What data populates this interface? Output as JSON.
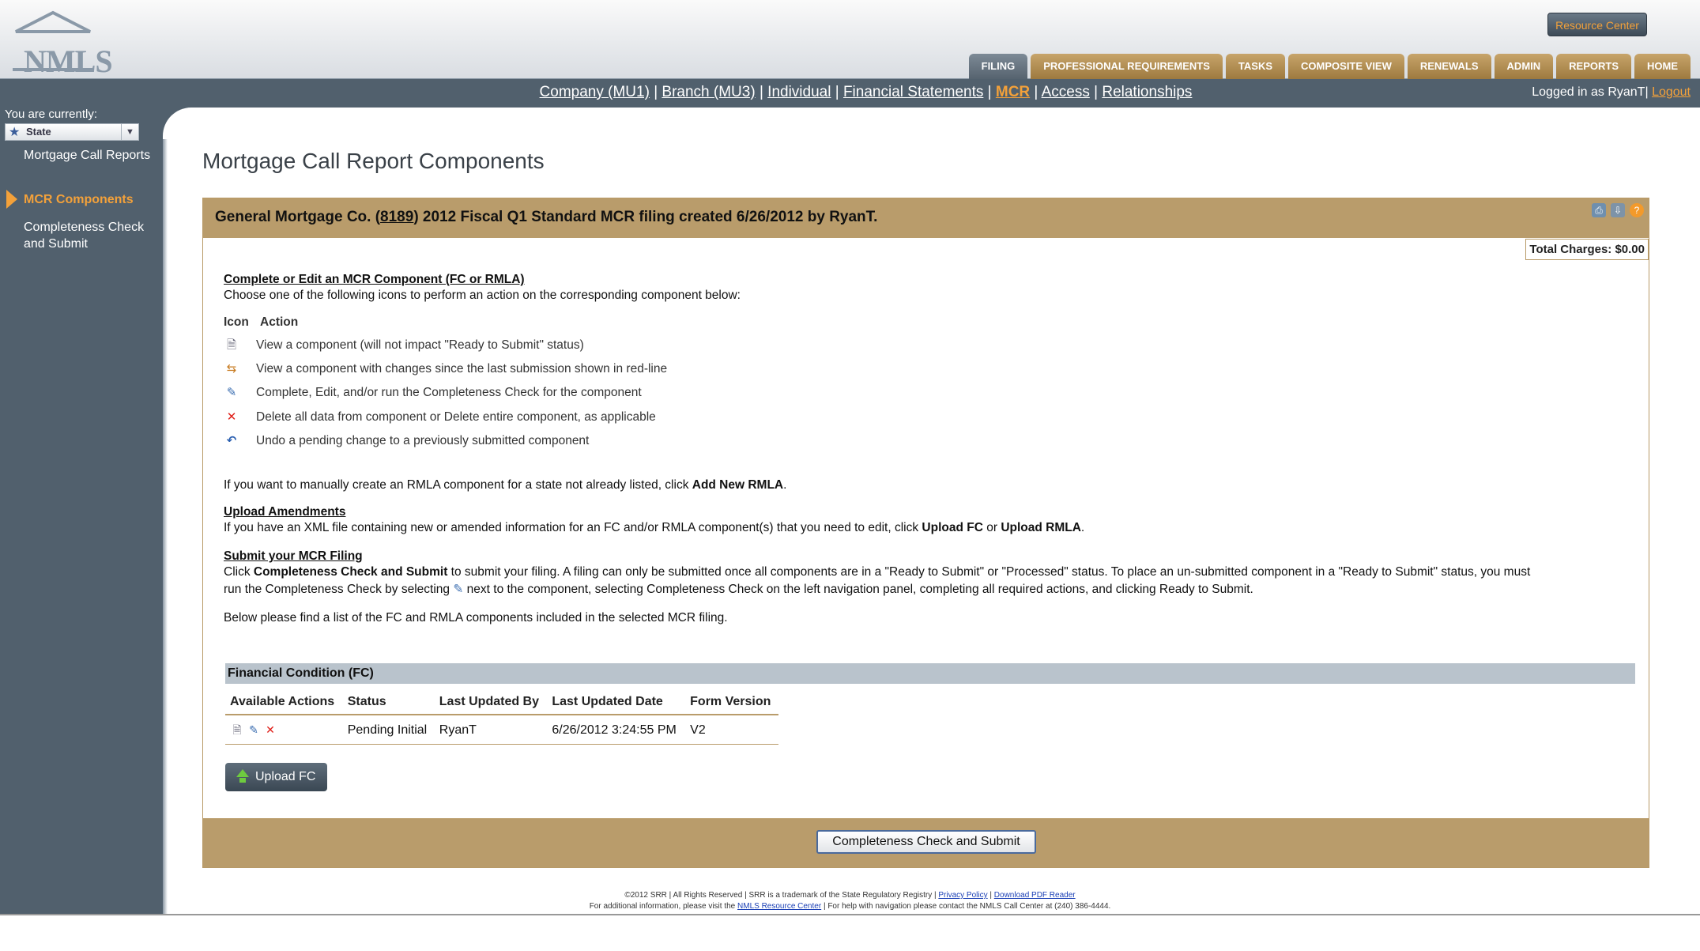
{
  "header": {
    "logo_text": "NMLS",
    "resource_center": "Resource Center",
    "tabs": [
      {
        "label": "FILING",
        "active": true
      },
      {
        "label": "PROFESSIONAL REQUIREMENTS",
        "active": false
      },
      {
        "label": "TASKS",
        "active": false
      },
      {
        "label": "COMPOSITE VIEW",
        "active": false
      },
      {
        "label": "RENEWALS",
        "active": false
      },
      {
        "label": "ADMIN",
        "active": false
      },
      {
        "label": "REPORTS",
        "active": false
      },
      {
        "label": "HOME",
        "active": false
      }
    ]
  },
  "subnav": {
    "links": [
      "Company (MU1)",
      "Branch (MU3)",
      "Individual",
      "Financial Statements",
      "MCR",
      "Access",
      "Relationships"
    ],
    "current": "MCR",
    "separator": " | ",
    "logged_in": "Logged in as RyanT",
    "logout": "Logout"
  },
  "sidebar": {
    "you_are": "You are currently:",
    "state_value": "State",
    "items": [
      {
        "label": "Mortgage Call Reports",
        "current": false
      },
      {
        "label": "MCR Components",
        "current": true
      },
      {
        "label": "Completeness Check and Submit",
        "current": false
      }
    ]
  },
  "main": {
    "page_title": "Mortgage Call Report Components",
    "panel_head": {
      "prefix": "General Mortgage Co. (",
      "id": "8189",
      "suffix": ") 2012 Fiscal Q1 Standard MCR filing created 6/26/2012 by RyanT."
    },
    "total_charges": "Total Charges: $0.00",
    "complete_heading": "Complete or Edit an MCR Component (FC or RMLA)",
    "complete_intro": "Choose one of the following icons to perform an action on the corresponding component below:",
    "legend_col_icon": "Icon",
    "legend_col_action": "Action",
    "legend": [
      {
        "icon": "view-document-icon",
        "text": "View a component (will not impact \"Ready to Submit\" status)"
      },
      {
        "icon": "view-changes-icon",
        "text": "View a component with changes since the last submission shown in red-line"
      },
      {
        "icon": "edit-icon",
        "text": "Complete, Edit, and/or run the Completeness Check for the component"
      },
      {
        "icon": "delete-icon",
        "text": "Delete all data from component or Delete entire component, as applicable"
      },
      {
        "icon": "undo-icon",
        "text": "Undo a pending change to a previously submitted component"
      }
    ],
    "rmla_text_pre": "If you want to manually create an RMLA component for a state not already listed, click ",
    "rmla_text_bold": "Add New RMLA",
    "rmla_text_post": ".",
    "upload_heading": "Upload Amendments",
    "upload_pre": "If you have an XML file containing new or amended information for an FC and/or RMLA component(s) that you need to edit, click ",
    "upload_bold1": "Upload FC",
    "upload_mid": " or ",
    "upload_bold2": "Upload RMLA",
    "upload_post": ".",
    "submit_heading": "Submit your MCR Filing",
    "submit_l1_pre": "Click ",
    "submit_l1_bold": "Completeness Check and Submit",
    "submit_l1_post": " to submit your filing. A filing can only be submitted once all components are in a \"Ready to Submit\" or \"Processed\" status. To place an un-submitted component in a \"Ready to Submit\" status, you must",
    "submit_l2_pre": "run the Completeness Check by selecting ",
    "submit_l2_post": " next to the component, selecting Completeness Check on the left navigation panel, completing all required actions, and clicking Ready to Submit.",
    "below_text": "Below please find a list of the FC and RMLA components included in the selected MCR filing.",
    "fc_section": "Financial Condition (FC)",
    "fc_columns": [
      "Available Actions",
      "Status",
      "Last Updated By",
      "Last Updated Date",
      "Form Version"
    ],
    "fc_rows": [
      {
        "status": "Pending Initial",
        "updated_by": "RyanT",
        "updated_date": "6/26/2012 3:24:55 PM",
        "version": "V2"
      }
    ],
    "upload_fc_button": "Upload FC",
    "cc_button": "Completeness Check and Submit"
  },
  "footer": {
    "line1_pre": "©2012 SRR | All Rights Reserved | SRR is a trademark of the State Regulatory Registry | ",
    "privacy": "Privacy Policy",
    "sep": " | ",
    "pdf": "Download PDF Reader",
    "line2_pre": "For additional information, please visit the ",
    "resource": "NMLS Resource Center",
    "line2_post": " | For help with navigation please contact the NMLS Call Center at (240) 386-4444."
  },
  "colors": {
    "accent": "#f3a13a",
    "panel": "#b99c6b",
    "nav": "#51606d"
  }
}
